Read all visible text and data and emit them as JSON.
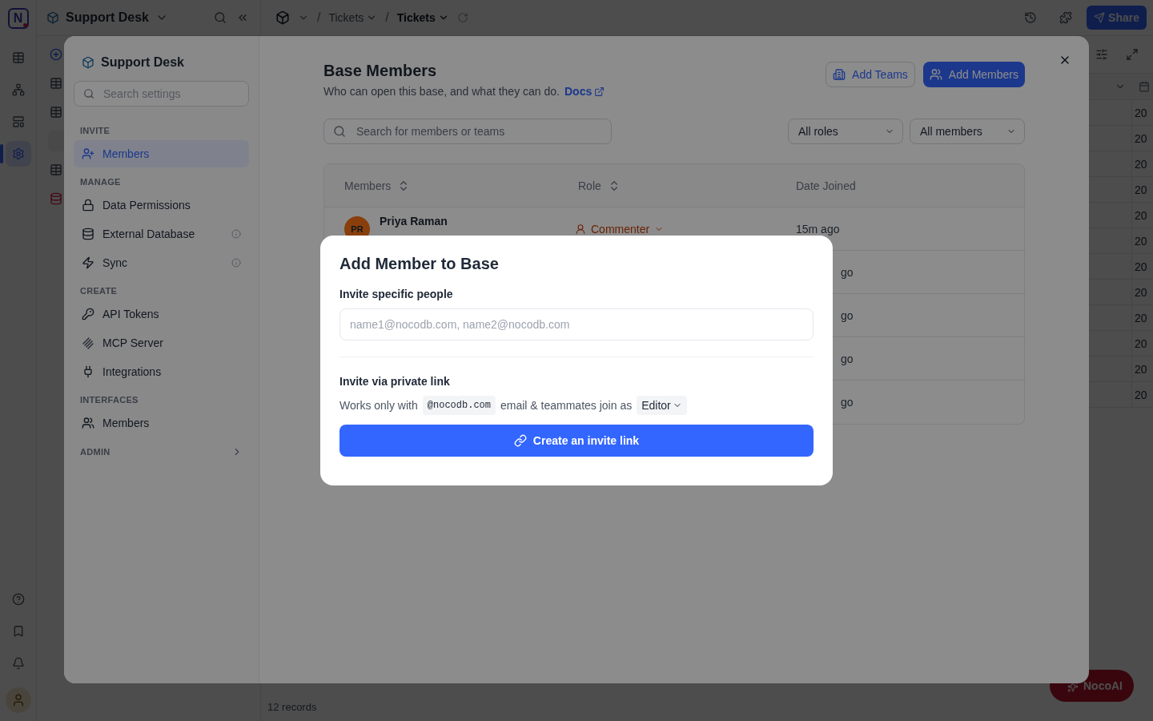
{
  "app": {
    "logo": "N",
    "base_name": "Support Desk",
    "breadcrumbs": [
      {
        "separator": "/",
        "label": "Tickets",
        "selected": false
      },
      {
        "separator": "/",
        "label": "Tickets",
        "selected": true
      }
    ],
    "share_button": "Share",
    "grid_cells": [
      "20",
      "20",
      "20",
      "20",
      "20",
      "20",
      "20",
      "20",
      "20",
      "20",
      "20",
      "20"
    ],
    "footer": "12 records",
    "ai_button": "NocoAI"
  },
  "settings": {
    "title": "Support Desk",
    "search_placeholder": "Search settings",
    "sections": [
      {
        "heading": "INVITE",
        "items": [
          {
            "label": "Members",
            "kind": "invite",
            "selected": true,
            "info": false
          }
        ]
      },
      {
        "heading": "MANAGE",
        "items": [
          {
            "label": "Data Permissions",
            "kind": "permissions",
            "selected": false,
            "info": false
          },
          {
            "label": "External Database",
            "kind": "database",
            "selected": false,
            "info": true
          },
          {
            "label": "Sync",
            "kind": "sync",
            "selected": false,
            "info": true
          }
        ]
      },
      {
        "heading": "CREATE",
        "items": [
          {
            "label": "API Tokens",
            "kind": "tokens",
            "selected": false,
            "info": false
          },
          {
            "label": "MCP Server",
            "kind": "server",
            "selected": false,
            "info": false
          },
          {
            "label": "Integrations",
            "kind": "integrations",
            "selected": false,
            "info": false
          }
        ]
      },
      {
        "heading": "INTERFACES",
        "items": [
          {
            "label": "Members",
            "kind": "interfaces",
            "selected": false,
            "info": false
          }
        ]
      }
    ],
    "admin": "ADMIN"
  },
  "members": {
    "title": "Base Members",
    "subtitle": "Who can open this base, and what they can do.",
    "docs_link": "Docs",
    "add_teams": "Add Teams",
    "add_members": "Add Members",
    "search_placeholder": "Search for members or teams",
    "filters": [
      "All roles",
      "All members"
    ],
    "columns": [
      {
        "label": "Members",
        "sortable": true
      },
      {
        "label": "Role",
        "sortable": true
      },
      {
        "label": "Date Joined",
        "sortable": false
      }
    ],
    "rows": [
      {
        "initials": "PR",
        "name": "Priya Raman",
        "role": "Commenter",
        "joined": "15m ago"
      },
      {
        "joined": "go"
      },
      {
        "joined": "go"
      },
      {
        "joined": "go"
      },
      {
        "joined": "go"
      }
    ]
  },
  "dialog": {
    "title": "Add Member to Base",
    "people_label": "Invite specific people",
    "people_placeholder": "name1@nocodb.com, name2@nocodb.com",
    "link_label": "Invite via private link",
    "link_text_before": "Works only with",
    "domain": "@nocodb.com",
    "link_text_after": "email & teammates join as",
    "role": "Editor",
    "create_button": "Create an invite link"
  }
}
